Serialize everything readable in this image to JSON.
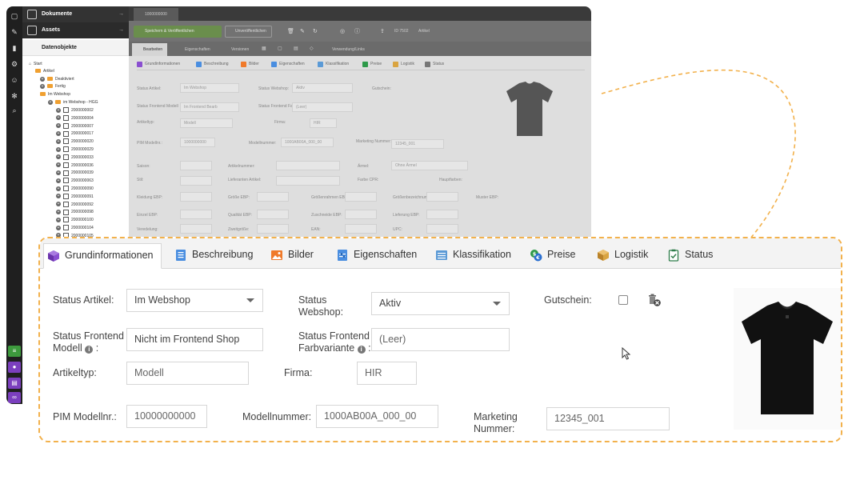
{
  "app": {
    "rail_colors": {
      "purple": "#7b3fbe",
      "green": "#3d9a3d"
    },
    "tree": {
      "documents": "Dokumente",
      "assets": "Assets",
      "data_objects": "Datenobjekte",
      "nodes": [
        "Start",
        "Artikel",
        "Deaktiviert",
        "Fertig",
        "Im Webshop",
        "im Webshop - HGG"
      ],
      "items": [
        "2000000002",
        "2000000004",
        "2000000007",
        "2000000017",
        "2000000020",
        "2000000029",
        "2000000033",
        "2000000036",
        "2000000039",
        "2000000063",
        "2000000090",
        "2000000091",
        "2000000092",
        "2000000098",
        "2000000100",
        "2000000104",
        "2000000105"
      ]
    },
    "tab_title": "1000000000",
    "toolbar": {
      "save_publish": "Speichern & Veröffentlichen",
      "unpublish": "Unveröffentlichen",
      "id_text": "ID 7502",
      "type_text": "Artikel"
    },
    "subtabs": [
      "Eigenschaften",
      "Versionen",
      "Verwendung/Links"
    ],
    "subtab_active": "Bearbeiten",
    "mini_tabs": [
      "Grundinformationen",
      "Beschreibung",
      "Bilder",
      "Eigenschaften",
      "Klassifikation",
      "Preise",
      "Logistik",
      "Status"
    ],
    "mini_fields": {
      "status_artikel": "Status Artikel:",
      "status_artikel_val": "Im Webshop",
      "status_webshop": "Status Webshop:",
      "status_webshop_val": "Aktiv",
      "gutschein": "Gutschein:",
      "frontend_modell": "Status Frontend Modell",
      "frontend_modell_val": "Im Frontend Bearb",
      "frontend_farb": "Status Frontend Farbvariante",
      "frontend_farb_val": "(Leer)",
      "artikeltyp": "Artikeltyp:",
      "artikeltyp_val": "Modell",
      "firma": "Firma:",
      "firma_val": "HIR",
      "pim": "PIM Modellnr.:",
      "pim_val": "1000000000",
      "modellnummer": "Modellnummer:",
      "modellnummer_val": "1000AB00A_000_00",
      "marketing": "Marketing Nummer:",
      "marketing_val": "12345_001",
      "saison": "Saison:",
      "artikelnummer": "Artikelnummer:",
      "aermel": "Ärmel:",
      "aermel_val": "Ohne Ärmel",
      "stil": "Stil:",
      "lieferanten": "Lieferanten Artikel:",
      "farbe": "Farbe CPR:",
      "hauptfarben": "Hauptfarben:",
      "groesse_row": [
        "Kleidung EBP:",
        "Größe EBP:",
        "Größenrahmen EBP:",
        "Größenbezeichnung EBP:",
        "Muster EBP:"
      ],
      "preis_row": [
        "Einzel EBP:",
        "Qualität EBP:",
        "Zuschneide EBP:",
        "Lieferung EBP:"
      ],
      "misc_row": [
        "Veredelung:",
        "Zweitgröße:",
        "EAN:",
        "UPC:"
      ]
    }
  },
  "zoom": {
    "tabs": {
      "grundinformationen": "Grundinformationen",
      "beschreibung": "Beschreibung",
      "bilder": "Bilder",
      "eigenschaften": "Eigenschaften",
      "klassifikation": "Klassifikation",
      "preise": "Preise",
      "logistik": "Logistik",
      "status": "Status"
    },
    "fields": {
      "status_artikel_label": "Status Artikel:",
      "status_artikel_value": "Im Webshop",
      "status_webshop_label_1": "Status",
      "status_webshop_label_2": "Webshop:",
      "status_webshop_value": "Aktiv",
      "gutschein_label": "Gutschein:",
      "frontend_modell_label_1": "Status Frontend",
      "frontend_modell_label_2": "Modell",
      "frontend_modell_value": "Nicht im Frontend Shop",
      "frontend_farb_label_1": "Status Frontend",
      "frontend_farb_label_2": "Farbvariante",
      "frontend_farb_value": "(Leer)",
      "artikeltyp_label": "Artikeltyp:",
      "artikeltyp_value": "Modell",
      "firma_label": "Firma:",
      "firma_value": "HIR",
      "pim_label": "PIM Modellnr.:",
      "pim_value": "10000000000",
      "modellnummer_label": "Modellnummer:",
      "modellnummer_value": "1000AB00A_000_00",
      "marketing_label_1": "Marketing",
      "marketing_label_2": "Nummer:",
      "marketing_value": "12345_001"
    },
    "colors": {
      "dashed_border": "#f2b14c",
      "accent": "#7b3fbe"
    }
  }
}
